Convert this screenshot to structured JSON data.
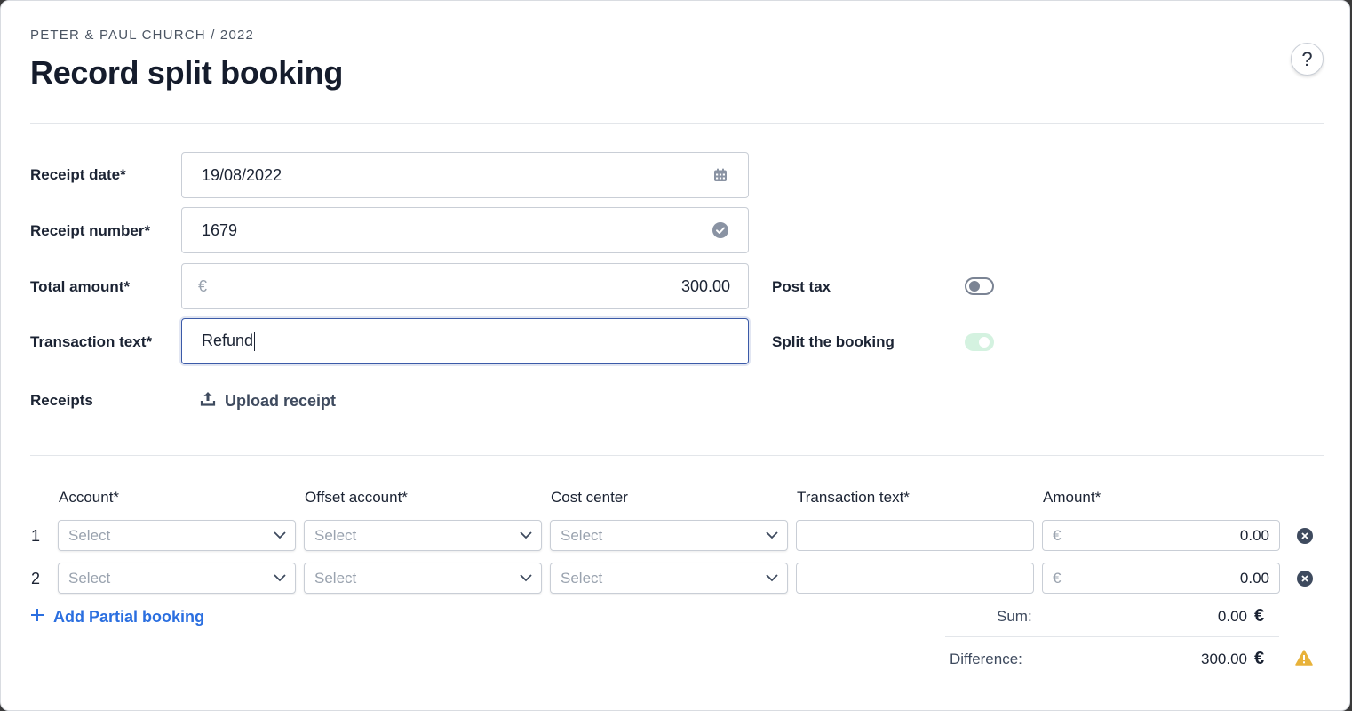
{
  "header": {
    "breadcrumb": "PETER & PAUL CHURCH / 2022",
    "title": "Record split booking",
    "help_label": "?"
  },
  "form": {
    "receipt_date": {
      "label": "Receipt date*",
      "value": "19/08/2022",
      "icon": "calendar-icon"
    },
    "receipt_number": {
      "label": "Receipt number*",
      "value": "1679",
      "icon": "check-circle-icon"
    },
    "total_amount": {
      "label": "Total amount*",
      "currency": "€",
      "value": "300.00"
    },
    "transaction_text": {
      "label": "Transaction text*",
      "value": "Refund"
    },
    "receipts": {
      "label": "Receipts",
      "upload_label": "Upload receipt",
      "icon": "upload-icon"
    },
    "post_tax": {
      "label": "Post tax",
      "checked": false
    },
    "split_booking": {
      "label": "Split the booking",
      "checked": true
    }
  },
  "split_table": {
    "columns": [
      "Account*",
      "Offset account*",
      "Cost center",
      "Transaction text*",
      "Amount*"
    ],
    "rows": [
      {
        "num": "1",
        "account": "Select",
        "offset_account": "Select",
        "cost_center": "Select",
        "text": "",
        "currency": "€",
        "amount": "0.00"
      },
      {
        "num": "2",
        "account": "Select",
        "offset_account": "Select",
        "cost_center": "Select",
        "text": "",
        "currency": "€",
        "amount": "0.00"
      }
    ],
    "add_label": "Add Partial booking"
  },
  "totals": {
    "sum_label": "Sum:",
    "sum_value": "0.00",
    "difference_label": "Difference:",
    "difference_value": "300.00",
    "currency": "€",
    "warning_icon": "warning-icon",
    "colors": {
      "warning": "#e8b23a",
      "link": "#2b6fe0",
      "toggle_on": "#d4f2e0"
    }
  }
}
